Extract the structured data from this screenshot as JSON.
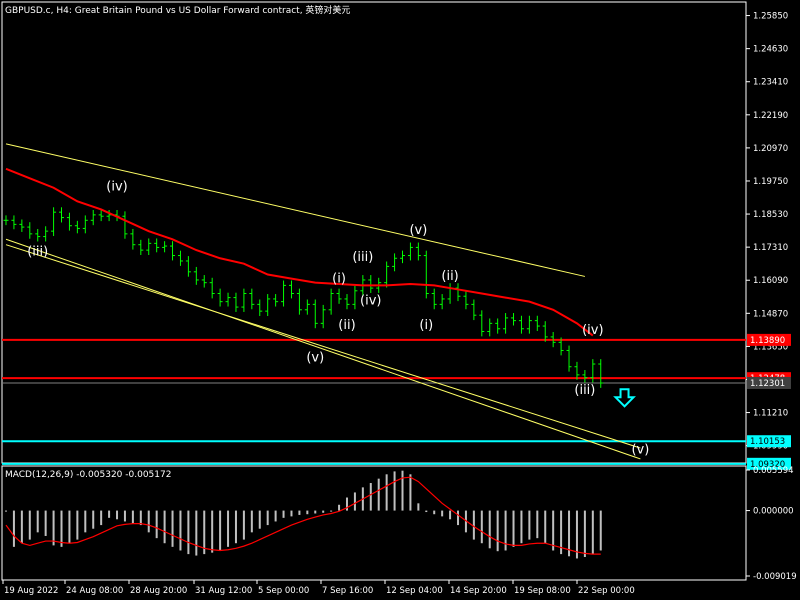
{
  "header": {
    "title": "GBPUSD.c, H4:  Great Britain Pound vs US Dollar Forward contract, 英镑对美元"
  },
  "macd": {
    "label": "MACD(12,26,9) -0.005320 -0.005172",
    "ticks": [
      "0.005594",
      "0.000000",
      "-0.009019"
    ],
    "values": [
      [
        0.005594,
        0.0
      ],
      [
        0.0,
        0.0
      ],
      [
        -0.009019,
        0.0
      ]
    ]
  },
  "colors": {
    "background": "#000000",
    "candles": "#00ff00",
    "moving_average": "#ff0000",
    "channel": "#ffff66",
    "resistance": "#ff0000",
    "target": "#00ffff",
    "macd_histogram": "#c0c0c0",
    "macd_signal": "#ff0000"
  },
  "chart_data": {
    "type": "line",
    "title": "GBPUSD.c, H4:  Great Britain Pound vs US Dollar Forward contract, 英镑对美元",
    "y_ticks": [
      "1.25850",
      "1.24630",
      "1.23410",
      "1.22190",
      "1.20970",
      "1.19750",
      "1.18530",
      "1.17310",
      "1.16090",
      "1.14870",
      "1.13650",
      "1.12430",
      "1.11210",
      "1.09990"
    ],
    "x_ticks": [
      "19 Aug 2022",
      "24 Aug 08:00",
      "28 Aug 20:00",
      "31 Aug 12:00",
      "5 Sep 00:00",
      "7 Sep 16:00",
      "12 Sep 04:00",
      "14 Sep 20:00",
      "19 Sep 08:00",
      "22 Sep 00:00"
    ],
    "ylim": [
      1.0935,
      1.2635
    ],
    "price_labels": [
      {
        "text": "1.13890",
        "value": 1.1389,
        "kind": "resistance"
      },
      {
        "text": "1.12478",
        "value": 1.12478,
        "kind": "resistance"
      },
      {
        "text": "1.12301",
        "value": 1.12301,
        "kind": "current"
      },
      {
        "text": "1.10153",
        "value": 1.10153,
        "kind": "target"
      },
      {
        "text": "1.09320",
        "value": 1.0932,
        "kind": "target"
      }
    ],
    "wave_labels": [
      {
        "text": "(iii)",
        "bar": 4,
        "price": 1.17
      },
      {
        "text": "(iv)",
        "bar": 14,
        "price": 1.194
      },
      {
        "text": "(v)",
        "bar": 39,
        "price": 1.131
      },
      {
        "text": "(i)",
        "bar": 42,
        "price": 1.16
      },
      {
        "text": "(ii)",
        "bar": 43,
        "price": 1.143
      },
      {
        "text": "(iii)",
        "bar": 45,
        "price": 1.168
      },
      {
        "text": "(iv)",
        "bar": 46,
        "price": 1.152
      },
      {
        "text": "(v)",
        "bar": 52,
        "price": 1.178
      },
      {
        "text": "(i)",
        "bar": 53,
        "price": 1.143
      },
      {
        "text": "(ii)",
        "bar": 56,
        "price": 1.161
      },
      {
        "text": "(iv)",
        "bar": 74,
        "price": 1.141
      },
      {
        "text": "(iii)",
        "bar": 73,
        "price": 1.119
      },
      {
        "text": "(v)",
        "bar": 80,
        "price": 1.097
      }
    ],
    "series": [
      {
        "name": "",
        "x": [
          0,
          1,
          2,
          3,
          4,
          5,
          6,
          7,
          8,
          9,
          10,
          11,
          12,
          13,
          14,
          15,
          16,
          17,
          18,
          19,
          20,
          21,
          22,
          23,
          24,
          25,
          26,
          27,
          28,
          29,
          30,
          31,
          32,
          33,
          34,
          35,
          36,
          37,
          38,
          39,
          40,
          41,
          42,
          43,
          44,
          45,
          46,
          47,
          48,
          49,
          50,
          51,
          52,
          53,
          54,
          55,
          56,
          57,
          58,
          59,
          60,
          61,
          62,
          63,
          64,
          65,
          66,
          67,
          68,
          69,
          70,
          71,
          72,
          73,
          74,
          75
        ],
        "values": [
          1.183,
          1.1815,
          1.1805,
          1.178,
          1.177,
          1.179,
          1.186,
          1.184,
          1.181,
          1.18,
          1.183,
          1.185,
          1.1845,
          1.185,
          1.1845,
          1.178,
          1.174,
          1.172,
          1.1745,
          1.173,
          1.1735,
          1.17,
          1.168,
          1.164,
          1.161,
          1.16,
          1.156,
          1.153,
          1.1545,
          1.151,
          1.156,
          1.152,
          1.1495,
          1.154,
          1.153,
          1.159,
          1.156,
          1.15,
          1.152,
          1.145,
          1.15,
          1.156,
          1.154,
          1.152,
          1.157,
          1.161,
          1.158,
          1.16,
          1.166,
          1.169,
          1.17,
          1.173,
          1.17,
          1.156,
          1.152,
          1.154,
          1.158,
          1.155,
          1.152,
          1.148,
          1.142,
          1.145,
          1.143,
          1.147,
          1.146,
          1.143,
          1.146,
          1.144,
          1.14,
          1.138,
          1.135,
          1.129,
          1.126,
          1.125,
          1.13,
          1.123
        ]
      },
      {
        "name": "",
        "x": [
          0,
          3,
          6,
          9,
          12,
          15,
          18,
          21,
          24,
          27,
          30,
          33,
          36,
          39,
          42,
          45,
          48,
          51,
          54,
          57,
          60,
          63,
          66,
          69,
          72,
          74
        ],
        "values": [
          1.202,
          1.1985,
          1.195,
          1.19,
          1.187,
          1.183,
          1.179,
          1.176,
          1.172,
          1.169,
          1.167,
          1.163,
          1.1615,
          1.16,
          1.1595,
          1.159,
          1.159,
          1.1595,
          1.159,
          1.1575,
          1.156,
          1.1545,
          1.153,
          1.15,
          1.145,
          1.1405
        ]
      }
    ],
    "channel_lines": [
      [
        [
          0,
          1.2112
        ],
        [
          73,
          1.1623
        ]
      ],
      [
        [
          0,
          1.174
        ],
        [
          80,
          1.099
        ]
      ],
      [
        [
          0,
          1.176
        ],
        [
          80,
          1.095
        ]
      ]
    ],
    "macd_histogram": [
      0.0,
      -0.005,
      -0.0045,
      -0.004,
      -0.003,
      -0.0035,
      -0.0048,
      -0.005,
      -0.0045,
      -0.004,
      -0.003,
      -0.0025,
      -0.002,
      -0.001,
      -0.0012,
      -0.0015,
      -0.0018,
      -0.002,
      -0.003,
      -0.0038,
      -0.0045,
      -0.005,
      -0.0055,
      -0.006,
      -0.0062,
      -0.006,
      -0.0058,
      -0.0055,
      -0.005,
      -0.0045,
      -0.004,
      -0.003,
      -0.0025,
      -0.002,
      -0.0015,
      -0.001,
      -0.0008,
      -0.0006,
      -0.0005,
      -0.0004,
      -0.0003,
      0.0,
      0.0008,
      0.0018,
      0.0025,
      0.0032,
      0.0038,
      0.0044,
      0.005,
      0.0054,
      0.0055,
      0.005,
      0.001,
      -0.0002,
      -0.0005,
      -0.0008,
      -0.0012,
      -0.002,
      -0.003,
      -0.004,
      -0.0045,
      -0.0052,
      -0.0056,
      -0.0055,
      -0.005,
      -0.0045,
      -0.004,
      -0.0038,
      -0.0045,
      -0.0055,
      -0.006,
      -0.0063,
      -0.0066,
      -0.0064,
      -0.006,
      -0.0055
    ],
    "macd_signal": [
      -0.002,
      -0.0035,
      -0.0045,
      -0.0048,
      -0.0045,
      -0.0042,
      -0.0042,
      -0.0044,
      -0.0045,
      -0.0044,
      -0.004,
      -0.0036,
      -0.0031,
      -0.0026,
      -0.0021,
      -0.0019,
      -0.0018,
      -0.0018,
      -0.002,
      -0.0024,
      -0.0029,
      -0.0034,
      -0.0039,
      -0.0044,
      -0.0048,
      -0.0052,
      -0.0054,
      -0.0055,
      -0.0054,
      -0.0052,
      -0.0049,
      -0.0045,
      -0.004,
      -0.0035,
      -0.003,
      -0.0025,
      -0.002,
      -0.0016,
      -0.0012,
      -0.0009,
      -0.0006,
      -0.0004,
      -0.0001,
      0.0004,
      0.001,
      0.0016,
      0.0022,
      0.0028,
      0.0034,
      0.004,
      0.0045,
      0.0046,
      0.004,
      0.003,
      0.002,
      0.001,
      0.0002,
      -0.0006,
      -0.0014,
      -0.0022,
      -0.0029,
      -0.0036,
      -0.0042,
      -0.0046,
      -0.0048,
      -0.0048,
      -0.0046,
      -0.0045,
      -0.0045,
      -0.0048,
      -0.0051,
      -0.0054,
      -0.0057,
      -0.0059,
      -0.006,
      -0.006
    ]
  }
}
